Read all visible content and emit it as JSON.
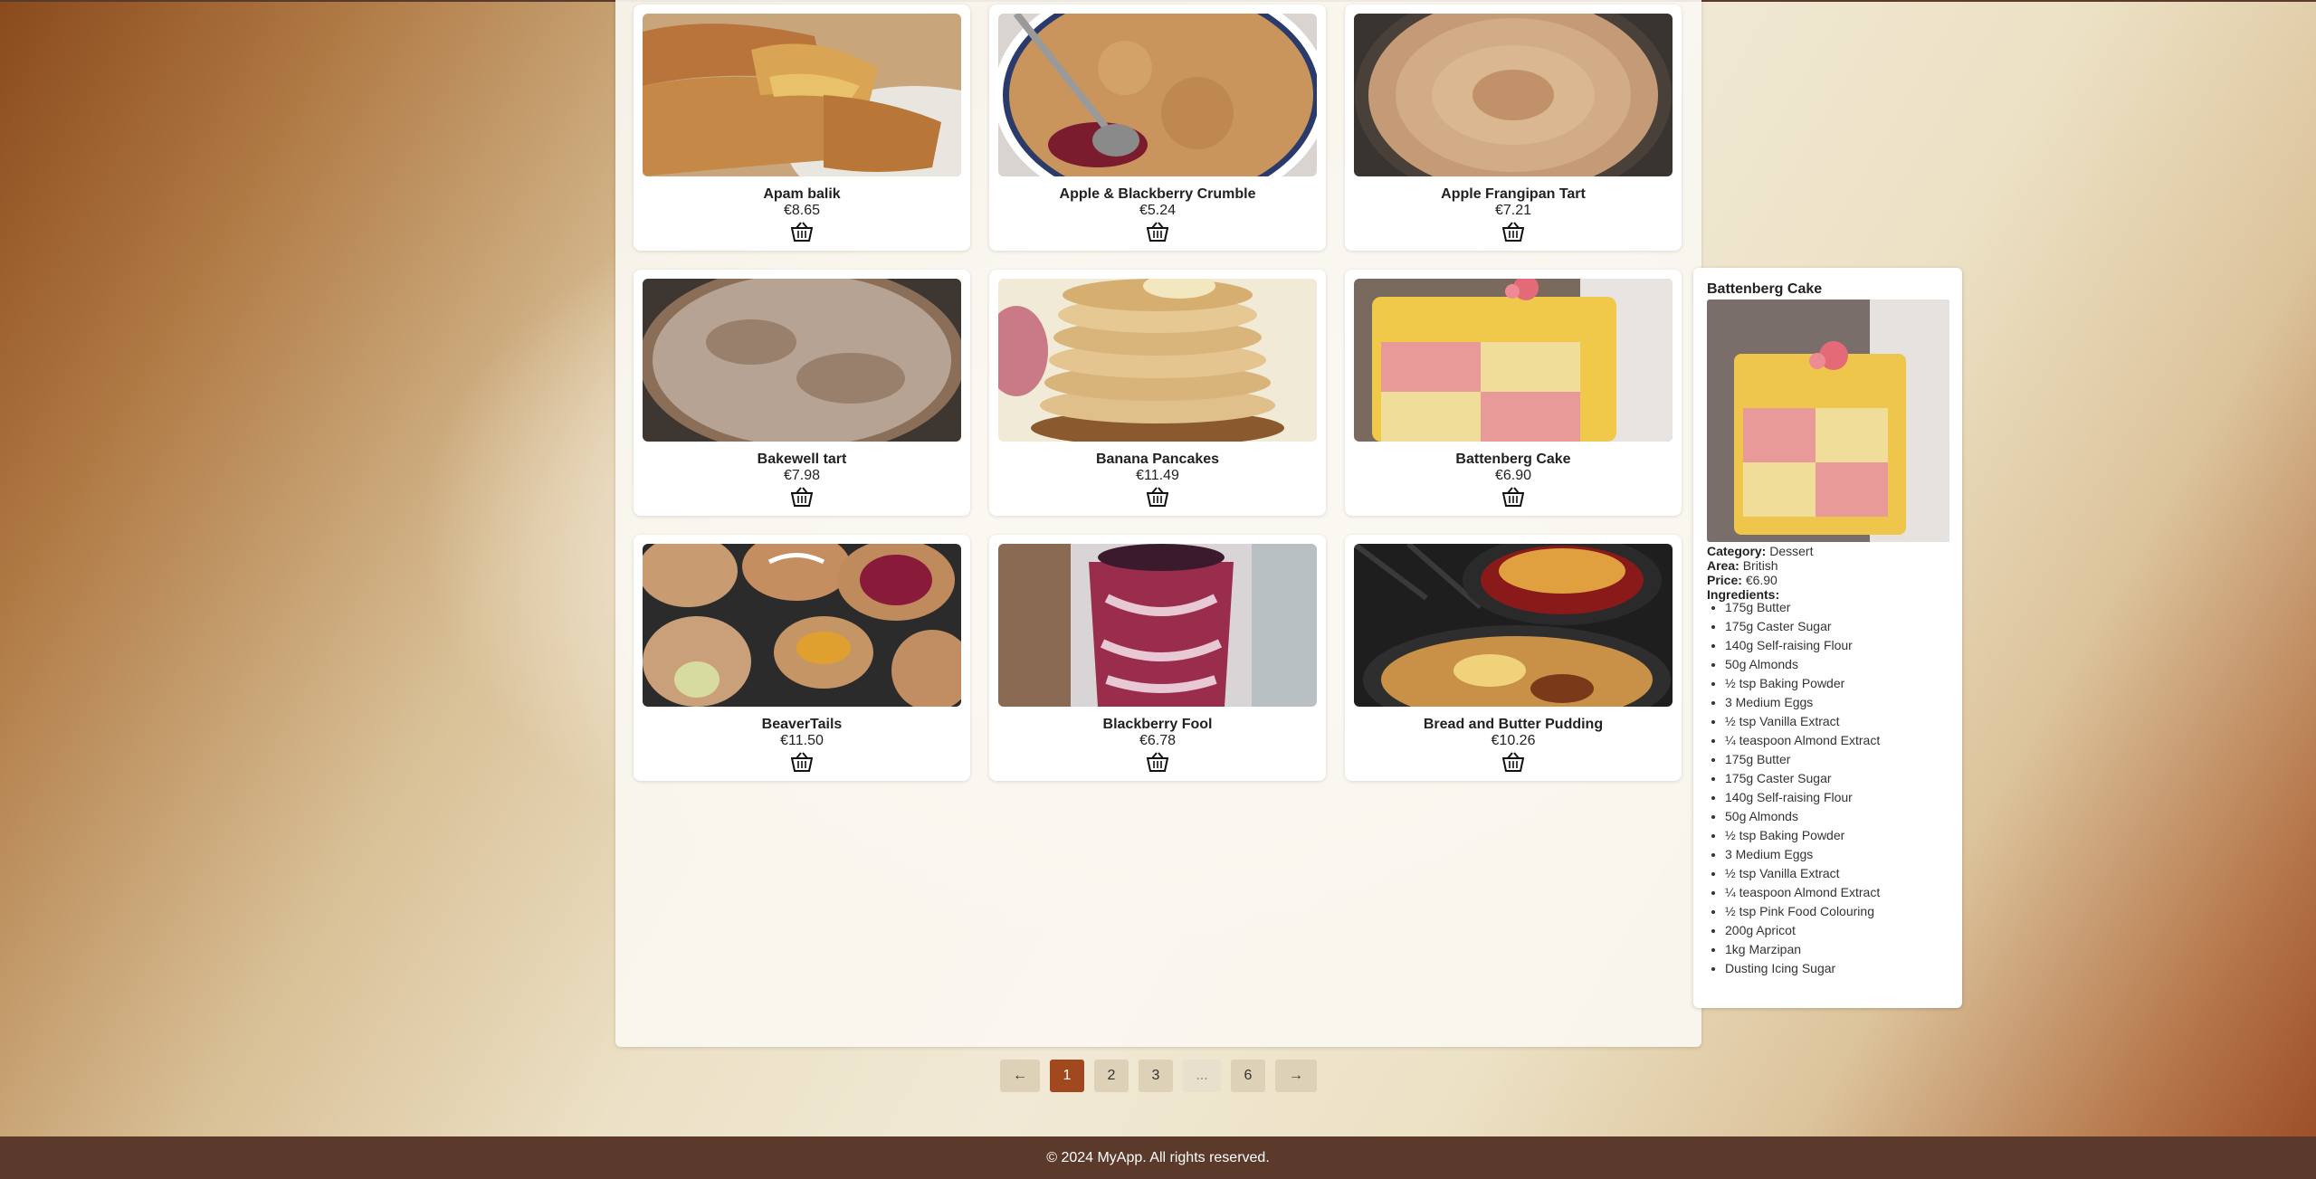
{
  "products": [
    {
      "name": "Apam balik",
      "price": "€8.65",
      "image": "apam-balik-photo"
    },
    {
      "name": "Apple & Blackberry Crumble",
      "price": "€5.24",
      "image": "apple-blackberry-crumble-photo"
    },
    {
      "name": "Apple Frangipan Tart",
      "price": "€7.21",
      "image": "apple-frangipan-tart-photo"
    },
    {
      "name": "Bakewell tart",
      "price": "€7.98",
      "image": "bakewell-tart-photo"
    },
    {
      "name": "Banana Pancakes",
      "price": "€11.49",
      "image": "banana-pancakes-photo"
    },
    {
      "name": "Battenberg Cake",
      "price": "€6.90",
      "image": "battenberg-cake-photo"
    },
    {
      "name": "BeaverTails",
      "price": "€11.50",
      "image": "beavertails-photo"
    },
    {
      "name": "Blackberry Fool",
      "price": "€6.78",
      "image": "blackberry-fool-photo"
    },
    {
      "name": "Bread and Butter Pudding",
      "price": "€10.26",
      "image": "bread-butter-pudding-photo"
    }
  ],
  "cart_icon": "basket-icon",
  "detail": {
    "title": "Battenberg Cake",
    "category_label": "Category:",
    "category": "Dessert",
    "area_label": "Area:",
    "area": "British",
    "price_label": "Price:",
    "price": "€6.90",
    "ingredients_label": "Ingredients:",
    "ingredients": [
      "175g Butter",
      "175g Caster Sugar",
      "140g Self-raising Flour",
      "50g Almonds",
      "½ tsp Baking Powder",
      "3 Medium Eggs",
      "½ tsp Vanilla Extract",
      "¼ teaspoon Almond Extract",
      "175g Butter",
      "175g Caster Sugar",
      "140g Self-raising Flour",
      "50g Almonds",
      "½ tsp Baking Powder",
      "3 Medium Eggs",
      "½ tsp Vanilla Extract",
      "¼ teaspoon Almond Extract",
      "½ tsp Pink Food Colouring",
      "200g Apricot",
      "1kg Marzipan",
      "Dusting Icing Sugar"
    ]
  },
  "pagination": {
    "prev": "←",
    "pages": [
      "1",
      "2",
      "3",
      "...",
      "6"
    ],
    "current": "1",
    "next": "→"
  },
  "footer": {
    "text": "© 2024 MyApp. All rights reserved."
  },
  "colors": {
    "accent": "#a2481f",
    "footer_bg": "#5b3a2b",
    "page_button": "#ddd2b8"
  }
}
